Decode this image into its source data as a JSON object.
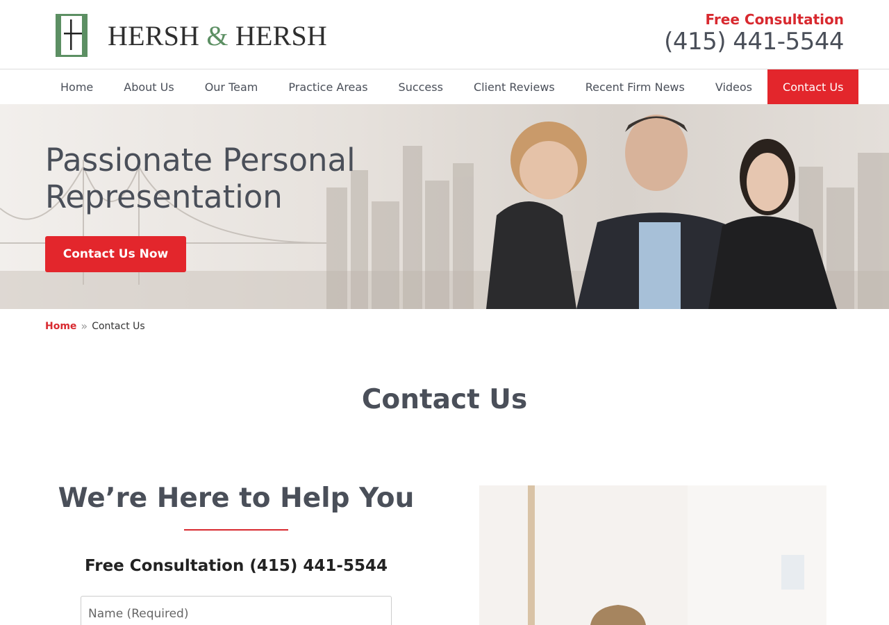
{
  "header": {
    "logo_text_left": "HERSH",
    "logo_text_amp": "&",
    "logo_text_right": "HERSH",
    "consult_label": "Free Consultation",
    "phone": "(415) 441-5544"
  },
  "nav": {
    "items": [
      {
        "label": "Home"
      },
      {
        "label": "About Us"
      },
      {
        "label": "Our Team"
      },
      {
        "label": "Practice Areas"
      },
      {
        "label": "Success"
      },
      {
        "label": "Client Reviews"
      },
      {
        "label": "Recent Firm News"
      },
      {
        "label": "Videos"
      },
      {
        "label": "Contact Us",
        "active": true
      }
    ]
  },
  "hero": {
    "title_line1": "Passionate Personal",
    "title_line2": "Representation",
    "button_label": "Contact Us Now"
  },
  "breadcrumb": {
    "home": "Home",
    "separator": "»",
    "current": "Contact Us"
  },
  "page": {
    "title": "Contact Us"
  },
  "help": {
    "title": "We’re Here to Help You",
    "consult": "Free Consultation (415) 441-5544",
    "name_placeholder": "Name (Required)"
  },
  "colors": {
    "accent": "#e3262c",
    "text": "#4a4f59",
    "logo_green": "#5c8f63"
  }
}
